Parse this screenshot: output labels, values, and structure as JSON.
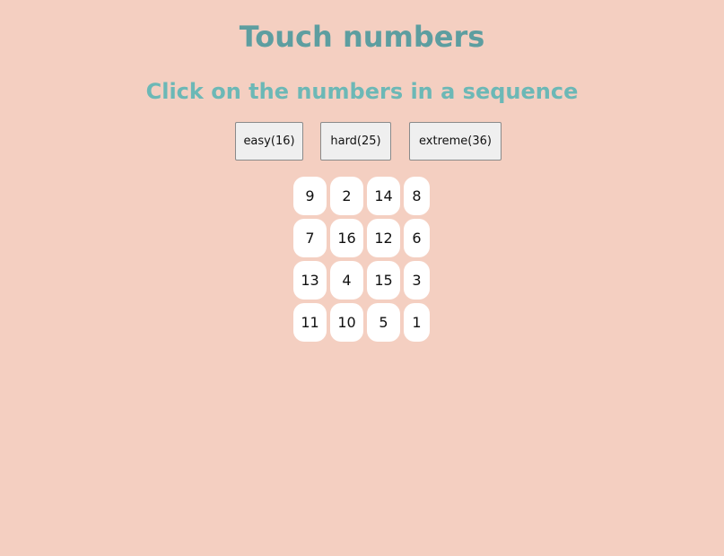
{
  "header": {
    "title": "Touch numbers",
    "subtitle": "Click on the numbers in a sequence"
  },
  "modes": {
    "easy_label": "easy(16)",
    "hard_label": "hard(25)",
    "extreme_label": "extreme(36)"
  },
  "board": {
    "rows": [
      [
        "9",
        "2",
        "14",
        "8"
      ],
      [
        "7",
        "16",
        "12",
        "6"
      ],
      [
        "13",
        "4",
        "15",
        "3"
      ],
      [
        "11",
        "10",
        "5",
        "1"
      ]
    ]
  },
  "colors": {
    "background": "#f4cfc1",
    "title": "#5d9ea0",
    "subtitle": "#6cb8b6",
    "tile": "#ffffff"
  }
}
